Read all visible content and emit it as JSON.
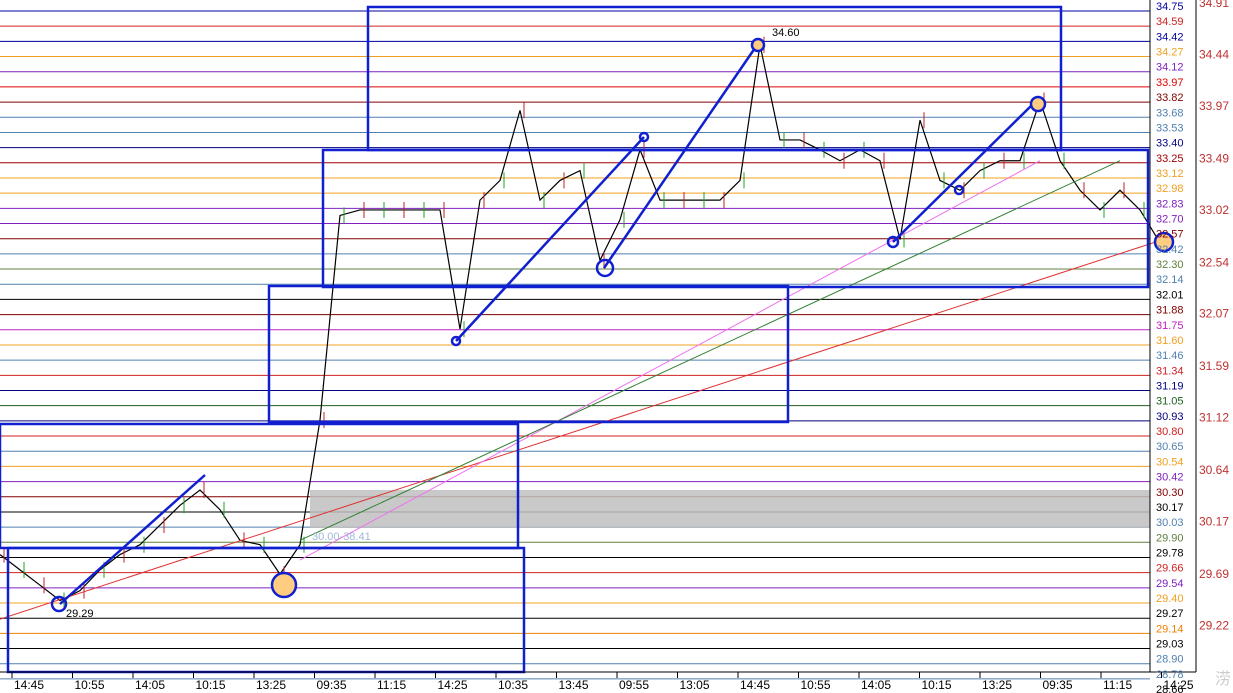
{
  "chart_data": {
    "type": "line",
    "title": "",
    "xlabel": "",
    "ylabel": "",
    "ylim": [
      28.6,
      34.91
    ],
    "grid": false,
    "x_tick_labels": [
      "14:45",
      "10:55",
      "14:05",
      "10:15",
      "13:25",
      "09:35",
      "11:15",
      "14:25",
      "10:35",
      "13:45",
      "09:55",
      "13:05",
      "14:45",
      "10:55",
      "14:05",
      "10:15",
      "13:25",
      "09:35",
      "11:15",
      "14:25"
    ],
    "outer_axis_labels": [
      "34.91",
      "34.44",
      "33.97",
      "33.49",
      "33.02",
      "32.54",
      "32.07",
      "31.59",
      "31.12",
      "30.64",
      "30.17",
      "29.69",
      "29.22"
    ],
    "level_lines": [
      {
        "v": "34.75",
        "c": "#0000a0"
      },
      {
        "v": "34.59",
        "c": "#d02020"
      },
      {
        "v": "34.42",
        "c": "#0000a0"
      },
      {
        "v": "34.27",
        "c": "#f0a020"
      },
      {
        "v": "34.12",
        "c": "#8020c0"
      },
      {
        "v": "33.97",
        "c": "#e00000"
      },
      {
        "v": "33.82",
        "c": "#800000"
      },
      {
        "v": "33.68",
        "c": "#5080b0"
      },
      {
        "v": "33.53",
        "c": "#5080b0"
      },
      {
        "v": "33.40",
        "c": "#000080"
      },
      {
        "v": "33.25",
        "c": "#a00000"
      },
      {
        "v": "33.12",
        "c": "#f0a020"
      },
      {
        "v": "32.98",
        "c": "#f0a020"
      },
      {
        "v": "32.83",
        "c": "#8020c0"
      },
      {
        "v": "32.70",
        "c": "#8020c0"
      },
      {
        "v": "32.57",
        "c": "#800000"
      },
      {
        "v": "32.42",
        "c": "#5080b0"
      },
      {
        "v": "32.30",
        "c": "#608040"
      },
      {
        "v": "32.14",
        "c": "#5080b0"
      },
      {
        "v": "32.01",
        "c": "#000000"
      },
      {
        "v": "31.88",
        "c": "#800000"
      },
      {
        "v": "31.75",
        "c": "#c020c0"
      },
      {
        "v": "31.60",
        "c": "#f0a020"
      },
      {
        "v": "31.46",
        "c": "#5080b0"
      },
      {
        "v": "31.34",
        "c": "#d02020"
      },
      {
        "v": "31.19",
        "c": "#000080"
      },
      {
        "v": "31.05",
        "c": "#206020"
      },
      {
        "v": "30.93",
        "c": "#000080"
      },
      {
        "v": "30.80",
        "c": "#d02020"
      },
      {
        "v": "30.65",
        "c": "#5080b0"
      },
      {
        "v": "30.54",
        "c": "#f0a020"
      },
      {
        "v": "30.42",
        "c": "#8020c0"
      },
      {
        "v": "30.30",
        "c": "#800000"
      },
      {
        "v": "30.17",
        "c": "#000000"
      },
      {
        "v": "30.03",
        "c": "#5080b0"
      },
      {
        "v": "29.90",
        "c": "#608040"
      },
      {
        "v": "29.78",
        "c": "#000000"
      },
      {
        "v": "29.66",
        "c": "#d02020"
      },
      {
        "v": "29.54",
        "c": "#8020c0"
      },
      {
        "v": "29.40",
        "c": "#f0a020"
      },
      {
        "v": "29.27",
        "c": "#000000"
      },
      {
        "v": "29.14",
        "c": "#f08000"
      },
      {
        "v": "29.03",
        "c": "#000000"
      },
      {
        "v": "28.90",
        "c": "#5080b0"
      },
      {
        "v": "28.78",
        "c": "#5080b0"
      },
      {
        "v": "28.66",
        "c": "#000000"
      }
    ],
    "series": [
      {
        "color": "#000000",
        "values": [
          29.85,
          29.71,
          29.57,
          29.43,
          29.52,
          29.71,
          29.85,
          29.94,
          30.12,
          30.3,
          30.44,
          30.26,
          29.98,
          29.94,
          29.67,
          29.94,
          31.08,
          32.95,
          33.0,
          33.0,
          33.0,
          33.0,
          33.0,
          31.91,
          33.09,
          33.27,
          33.91,
          33.09,
          33.27,
          33.36,
          32.54,
          32.91,
          33.55,
          33.09,
          33.09,
          33.09,
          33.09,
          33.27,
          34.51,
          33.64,
          33.64,
          33.55,
          33.45,
          33.55,
          33.45,
          32.73,
          33.82,
          33.27,
          33.18,
          33.36,
          33.45,
          33.45,
          34.0,
          33.45,
          33.18,
          33.0,
          33.18,
          33.0,
          32.7
        ]
      },
      {
        "color": "#e03030",
        "start": [
          0,
          29.26
        ],
        "end": [
          58,
          32.72
        ]
      },
      {
        "color": "#f070f0",
        "start": [
          15,
          29.8
        ],
        "end": [
          52,
          33.45
        ]
      },
      {
        "color": "#308030",
        "start": [
          15,
          29.98
        ],
        "end": [
          56,
          33.45
        ]
      }
    ],
    "annotations": {
      "high": "34.60",
      "low": "29.29",
      "range": "30.00-38.41"
    }
  },
  "colors": {
    "drawing": "#1020d0",
    "highlight": "#ffcc80",
    "band": "#c0c0c0"
  },
  "watermark": "涝"
}
